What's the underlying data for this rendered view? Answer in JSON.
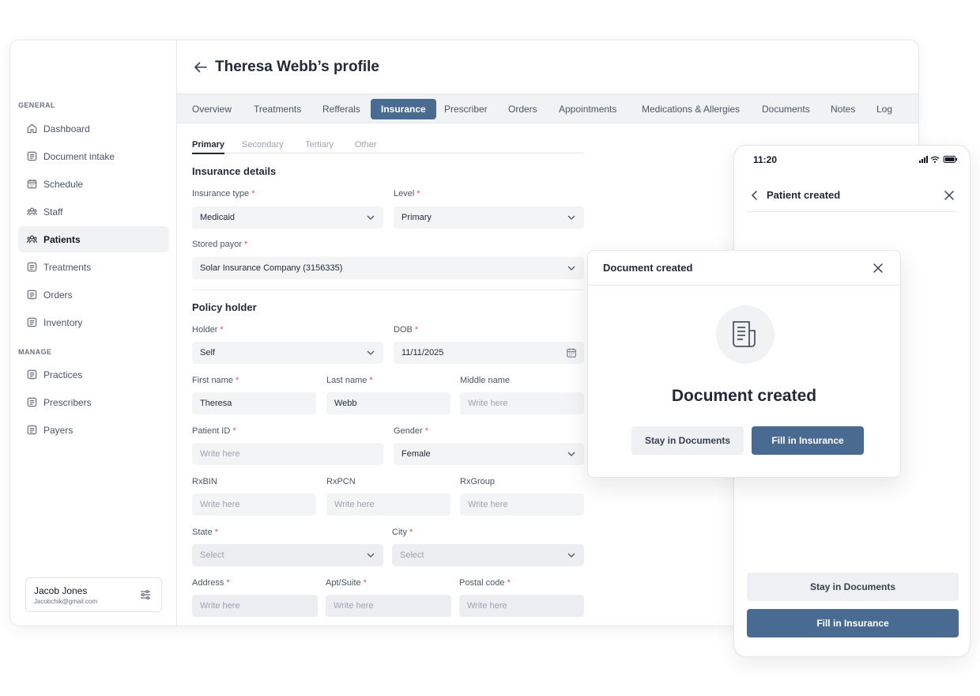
{
  "page": {
    "title": "Theresa Webb’s profile"
  },
  "sidebar": {
    "sections": [
      "GENERAL",
      "MANAGE"
    ],
    "items": [
      {
        "label": "Dashboard",
        "icon": "home-icon"
      },
      {
        "label": "Document intake",
        "icon": "document-icon"
      },
      {
        "label": "Schedule",
        "icon": "calendar-icon"
      },
      {
        "label": "Staff",
        "icon": "users-icon"
      },
      {
        "label": "Patients",
        "icon": "users-icon",
        "active": true
      },
      {
        "label": "Treatments",
        "icon": "document-icon"
      },
      {
        "label": "Orders",
        "icon": "document-icon"
      },
      {
        "label": "Inventory",
        "icon": "document-icon"
      },
      {
        "label": "Practices",
        "icon": "document-icon"
      },
      {
        "label": "Prescribers",
        "icon": "document-icon"
      },
      {
        "label": "Payers",
        "icon": "document-icon"
      }
    ],
    "user": {
      "name": "Jacob Jones",
      "email": "Jacobchik@gmail.com"
    }
  },
  "tabs": [
    "Overview",
    "Treatments",
    "Refferals",
    "Insurance",
    "Prescriber",
    "Orders",
    "Appointments",
    "Medications & Allergies",
    "Documents",
    "Notes",
    "Log"
  ],
  "active_tab": "Insurance",
  "subtabs": [
    "Primary",
    "Secondary",
    "Tertiary",
    "Other"
  ],
  "active_subtab": "Primary",
  "form": {
    "insurance_title": "Insurance details",
    "policy_title": "Policy holder",
    "insurance_type": {
      "label": "Insurance type",
      "value": "Medicaid"
    },
    "level": {
      "label": "Level",
      "value": "Primary"
    },
    "stored_payor": {
      "label": "Stored payor",
      "value": "Solar Insurance Company (3156335)"
    },
    "holder": {
      "label": "Holder",
      "value": "Self"
    },
    "dob": {
      "label": "DOB",
      "value": "11/11/2025"
    },
    "first_name": {
      "label": "First name",
      "value": "Theresa"
    },
    "last_name": {
      "label": "Last name",
      "value": "Webb"
    },
    "middle_name": {
      "label": "Middle name",
      "placeholder": "Write here"
    },
    "patient_id": {
      "label": "Patient ID",
      "placeholder": "Write here"
    },
    "gender": {
      "label": "Gender",
      "value": "Female"
    },
    "rxbin": {
      "label": "RxBIN",
      "placeholder": "Write here"
    },
    "rxpcn": {
      "label": "RxPCN",
      "placeholder": "Write here"
    },
    "rxgroup": {
      "label": "RxGroup",
      "placeholder": "Write here"
    },
    "state": {
      "label": "State",
      "placeholder": "Select"
    },
    "city": {
      "label": "City",
      "placeholder": "Select"
    },
    "address": {
      "label": "Address",
      "placeholder": "Write here"
    },
    "apt": {
      "label": "Apt/Suite",
      "placeholder": "Write here"
    },
    "postal": {
      "label": "Postal code",
      "placeholder": "Write here"
    }
  },
  "phone": {
    "time": "11:20",
    "title": "Patient created",
    "secondary_button": "Stay in Documents",
    "primary_button": "Fill in Insurance"
  },
  "dialog": {
    "title": "Document created",
    "heading": "Document created",
    "secondary_button": "Stay in Documents",
    "primary_button": "Fill in Insurance"
  },
  "colors": {
    "accent": "#4a6b91",
    "required": "#e05252",
    "field_bg": "#f3f4f6"
  }
}
